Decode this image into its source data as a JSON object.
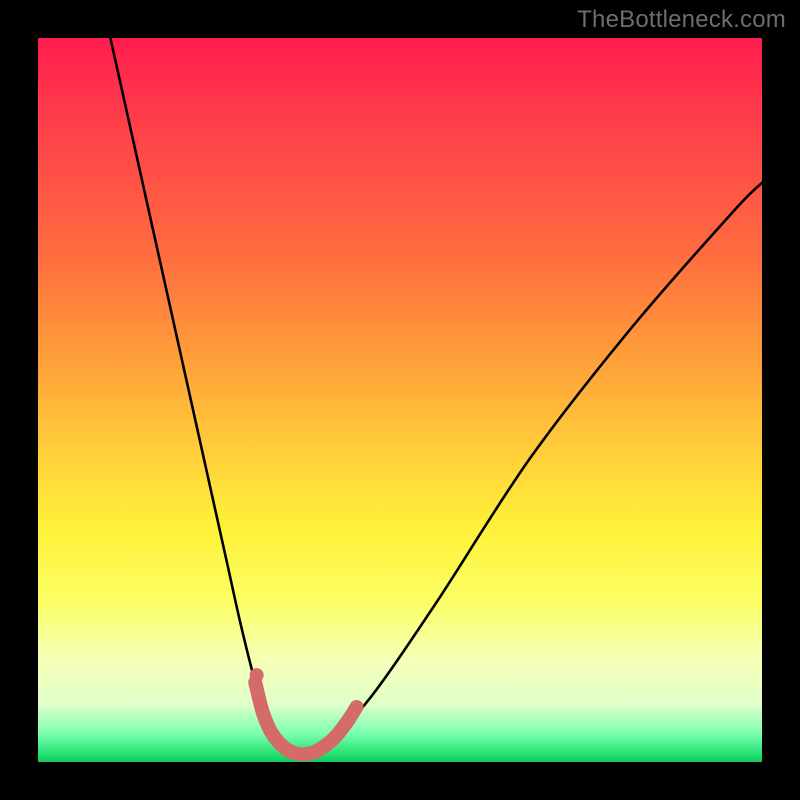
{
  "watermark": "TheBottleneck.com",
  "chart_data": {
    "type": "line",
    "title": "",
    "xlabel": "",
    "ylabel": "",
    "xlim": [
      0,
      100
    ],
    "ylim": [
      0,
      100
    ],
    "series": [
      {
        "name": "bottleneck-curve",
        "x": [
          10,
          14,
          18,
          22,
          26,
          28,
          30,
          31.5,
          33,
          34.5,
          36,
          37,
          38,
          40,
          46,
          55,
          68,
          82,
          96,
          100
        ],
        "values": [
          100,
          82,
          64,
          46,
          28,
          19,
          11,
          6,
          3,
          1.5,
          1,
          1,
          1.2,
          2.5,
          9,
          22,
          42,
          60,
          76,
          80
        ]
      },
      {
        "name": "highlight-bottom",
        "x": [
          30,
          31,
          32,
          33,
          34,
          35,
          36,
          37,
          38,
          39,
          40,
          41,
          42,
          43,
          44
        ],
        "values": [
          11,
          7,
          4.5,
          3,
          2,
          1.4,
          1.1,
          1.1,
          1.3,
          1.8,
          2.5,
          3.4,
          4.6,
          6.0,
          7.6
        ]
      },
      {
        "name": "highlight-dot",
        "x": [
          30.2
        ],
        "values": [
          12
        ]
      }
    ],
    "colors": {
      "curve": "#000000",
      "highlight": "#d46a6a",
      "gradient_top": "#ff1c4e",
      "gradient_mid": "#ffd13a",
      "gradient_bottom": "#17c45e"
    }
  }
}
